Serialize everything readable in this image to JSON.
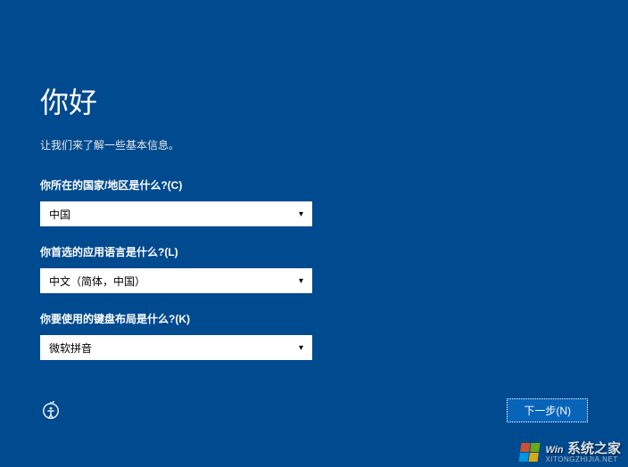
{
  "header": {
    "title": "你好",
    "subtitle": "让我们来了解一些基本信息。"
  },
  "fields": {
    "country": {
      "label": "你所在的国家/地区是什么?(C)",
      "value": "中国"
    },
    "language": {
      "label": "你首选的应用语言是什么?(L)",
      "value": "中文（简体，中国）"
    },
    "keyboard": {
      "label": "你要使用的键盘布局是什么?(K)",
      "value": "微软拼音"
    }
  },
  "footer": {
    "next_label": "下一步(N)"
  },
  "watermark": {
    "main": "系统之家",
    "prefix": "Win",
    "sub": "XITONGZHIJIA.NET"
  }
}
